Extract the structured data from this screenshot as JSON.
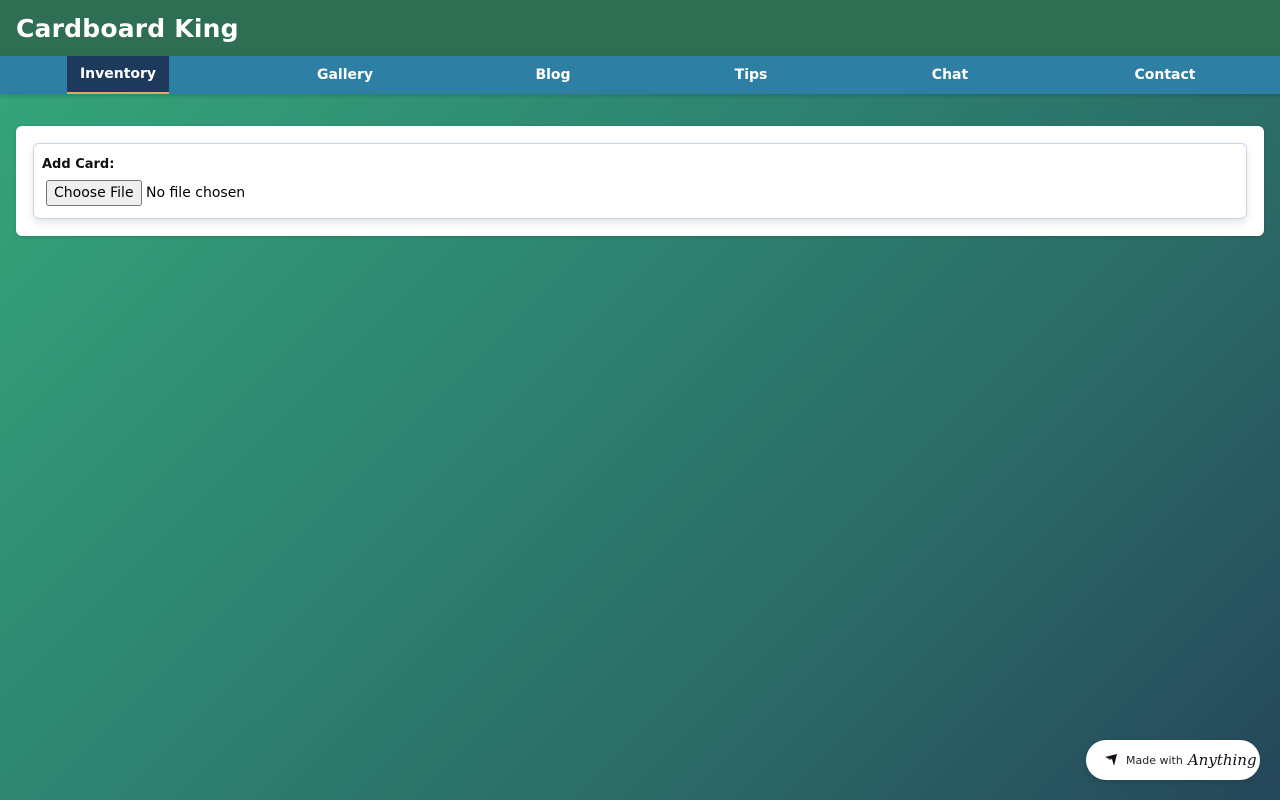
{
  "app": {
    "title": "Cardboard King"
  },
  "nav": {
    "items": [
      {
        "label": "Inventory",
        "active": true
      },
      {
        "label": "Gallery",
        "active": false
      },
      {
        "label": "Blog",
        "active": false
      },
      {
        "label": "Tips",
        "active": false
      },
      {
        "label": "Chat",
        "active": false
      },
      {
        "label": "Contact",
        "active": false
      }
    ]
  },
  "main": {
    "add_card_label": "Add Card:",
    "file_input": {
      "button_label": "Choose File",
      "status": "No file chosen"
    }
  },
  "badge": {
    "prefix": "Made with",
    "brand": "Anything",
    "icon": "anything-logo-icon"
  },
  "colors": {
    "header": "#2e6e52",
    "nav": "#2d7fa3",
    "nav_active": "#1d3a5c",
    "nav_active_underline": "#e2a56a"
  }
}
